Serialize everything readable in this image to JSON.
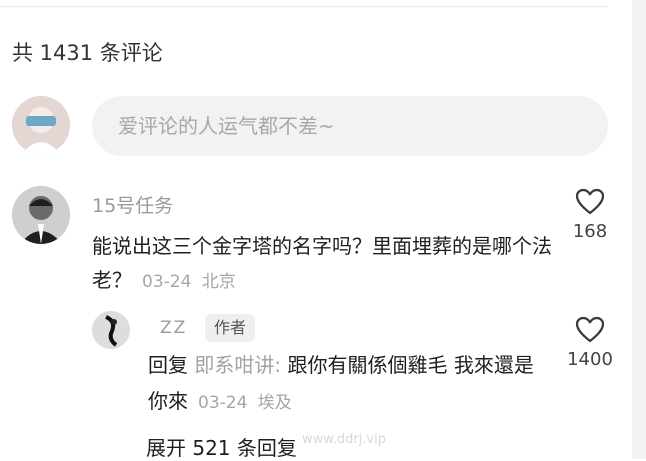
{
  "comments": {
    "count_text": "共 1431 条评论",
    "input_placeholder": "爱评论的人运气都不差~"
  },
  "comment1": {
    "username": "15号任务",
    "text": "能说出这三个金字塔的名字吗？里面埋葬的是哪个法老？",
    "date": "03-24",
    "location": "北京",
    "likes": "168"
  },
  "reply1": {
    "username": "ZZ",
    "author_badge": "作者",
    "reply_prefix": "回复",
    "reply_to": "即系咁讲:",
    "text": "跟你有關係個雞毛 我來還是你來",
    "date": "03-24",
    "location": "埃及",
    "likes": "1400"
  },
  "expand_text": "展开 521 条回复",
  "watermark": "www.ddrj.vip"
}
